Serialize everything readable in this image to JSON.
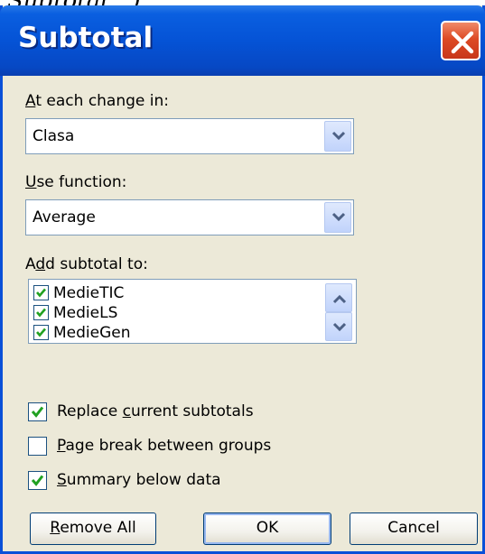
{
  "page_fragment": "Subtotal…).",
  "dialog": {
    "title": "Subtotal",
    "at_each_change": {
      "label_u": "A",
      "label_rest": "t each change in:",
      "value": "Clasa"
    },
    "use_function": {
      "label_u": "U",
      "label_rest": "se function:",
      "value": "Average"
    },
    "add_subtotal": {
      "label_pre": "A",
      "label_u": "d",
      "label_rest": "d subtotal to:",
      "items": [
        {
          "label": "MedieTIC",
          "checked": true
        },
        {
          "label": "MedieLS",
          "checked": true
        },
        {
          "label": "MedieGen",
          "checked": true
        }
      ]
    },
    "options": {
      "replace": {
        "pre": "Replace ",
        "u": "c",
        "rest": "urrent subtotals",
        "checked": true
      },
      "page_break": {
        "pre": "",
        "u": "P",
        "rest": "age break between groups",
        "checked": false
      },
      "summary": {
        "pre": "",
        "u": "S",
        "rest": "ummary below data",
        "checked": true
      }
    },
    "buttons": {
      "remove_u": "R",
      "remove_rest": "emove All",
      "ok": "OK",
      "cancel": "Cancel"
    }
  },
  "colors": {
    "titlebar": "#0553d6",
    "close": "#dd4a24",
    "check": "#21a121",
    "face": "#ece9d8"
  },
  "icons": {
    "close": "close-icon",
    "dropdown": "chevron-down-icon",
    "scroll_up": "chevron-up-icon",
    "scroll_down": "chevron-down-icon",
    "check": "checkmark-icon"
  }
}
